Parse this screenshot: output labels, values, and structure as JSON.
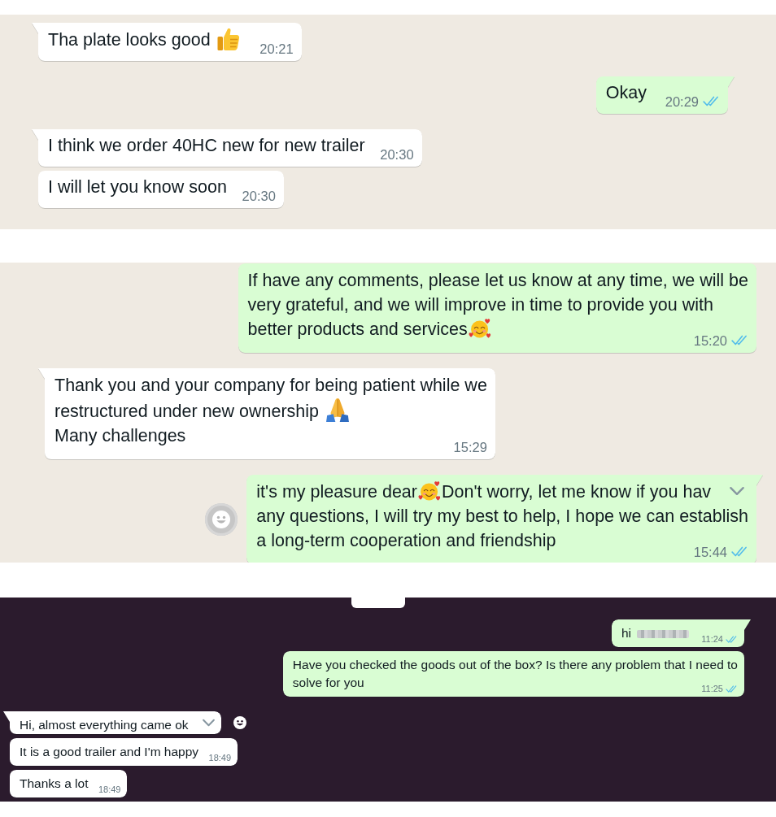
{
  "panels": [
    {
      "kind": "light",
      "date_chip": false,
      "messages": [
        {
          "kind": "incoming",
          "tail": true,
          "hovered": false,
          "time": "20:21",
          "lines": [
            [
              {
                "kind": "text",
                "text": "Tha plate looks good"
              },
              {
                "kind": "thumbs_up"
              }
            ]
          ]
        },
        {
          "kind": "outgoing",
          "tail": true,
          "hovered": false,
          "time": "20:29",
          "read": true,
          "lines": [
            [
              {
                "kind": "text",
                "text": "Okay"
              }
            ]
          ]
        },
        {
          "kind": "incoming",
          "tail": true,
          "hovered": false,
          "time": "20:30",
          "lines": [
            [
              {
                "kind": "text",
                "text": "I think we order 40HC new for new trailer"
              }
            ]
          ]
        },
        {
          "kind": "incoming",
          "tail": false,
          "hovered": false,
          "time": "20:30",
          "lines": [
            [
              {
                "kind": "text",
                "text": "I will let you know soon"
              }
            ]
          ]
        }
      ]
    },
    {
      "kind": "light",
      "date_chip": false,
      "messages": [
        {
          "kind": "outgoing",
          "tail": false,
          "hovered": false,
          "time": "15:20",
          "read": true,
          "lines": [
            [
              {
                "kind": "text",
                "text": "If have any comments, please let us know at any time, we will be"
              }
            ],
            [
              {
                "kind": "text",
                "text": "very grateful, and we will improve in time to provide you with"
              }
            ],
            [
              {
                "kind": "text",
                "text": "better products and services"
              },
              {
                "kind": "smiling_hearts"
              }
            ]
          ]
        },
        {
          "kind": "incoming",
          "tail": true,
          "hovered": false,
          "time": "15:29",
          "lines": [
            [
              {
                "kind": "text",
                "text": "Thank you and your company for being patient while we"
              }
            ],
            [
              {
                "kind": "text",
                "text": "restructured under new ownership"
              },
              {
                "kind": "folded_hands"
              }
            ],
            [
              {
                "kind": "text",
                "text": "Many challenges"
              }
            ]
          ]
        },
        {
          "kind": "outgoing",
          "tail": true,
          "hovered": true,
          "time": "15:44",
          "read": true,
          "lines": [
            [
              {
                "kind": "text",
                "text": "it's my pleasure dear"
              },
              {
                "kind": "smiling_hearts"
              },
              {
                "kind": "text",
                "text": "Don't worry, let me know if you hav"
              }
            ],
            [
              {
                "kind": "text",
                "text": "any questions, I will try my best to help, I hope we can establish"
              }
            ],
            [
              {
                "kind": "text",
                "text": "a long-term cooperation and friendship"
              }
            ]
          ]
        }
      ]
    },
    {
      "kind": "dark",
      "date_chip": true,
      "messages": [
        {
          "kind": "outgoing",
          "tail": true,
          "hovered": false,
          "time": "11:24",
          "read": true,
          "lines": [
            [
              {
                "kind": "text",
                "text": "hi"
              },
              {
                "kind": "redacted"
              }
            ]
          ]
        },
        {
          "kind": "outgoing",
          "tail": false,
          "hovered": false,
          "time": "11:25",
          "read": true,
          "lines": [
            [
              {
                "kind": "text",
                "text": "Have you checked the goods out of the box? Is there any problem that I need to"
              }
            ],
            [
              {
                "kind": "text",
                "text": "solve for you"
              }
            ]
          ]
        },
        {
          "kind": "incoming",
          "tail": true,
          "hovered": true,
          "lines": [
            [
              {
                "kind": "text",
                "text": "Hi, almost everything came ok"
              }
            ]
          ]
        },
        {
          "kind": "incoming",
          "tail": false,
          "hovered": false,
          "time": "18:49",
          "lines": [
            [
              {
                "kind": "text",
                "text": "It is a good trailer and I'm happy"
              }
            ]
          ]
        },
        {
          "kind": "incoming",
          "tail": false,
          "hovered": false,
          "time": "18:49",
          "lines": [
            [
              {
                "kind": "text",
                "text": "Thanks a lot"
              }
            ]
          ]
        }
      ]
    }
  ]
}
